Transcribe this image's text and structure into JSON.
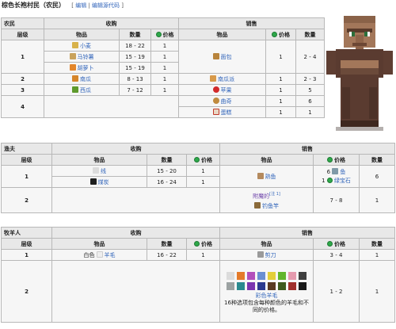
{
  "header": {
    "title": "棕色长袍村民（农民）",
    "edit": "编辑",
    "edit_source": "编辑源代码"
  },
  "emerald_price_label": "价格",
  "farmer": {
    "profession": "农民",
    "buy_header": "收购",
    "sell_header": "销售",
    "col_tier": "层级",
    "col_item": "物品",
    "col_qty": "数量",
    "col_qty2": "数量",
    "tiers": [
      {
        "tier": "1",
        "buys": [
          {
            "item": "小麦",
            "qty": "18 - 22",
            "price": "1"
          },
          {
            "item": "马铃薯",
            "qty": "15 - 19",
            "price": "1"
          },
          {
            "item": "胡萝卜",
            "qty": "15 - 19",
            "price": "1"
          }
        ],
        "sells": [
          {
            "item": "面包",
            "price": "1",
            "qty": "2 - 4"
          }
        ]
      },
      {
        "tier": "2",
        "buys": [
          {
            "item": "南瓜",
            "qty": "8 - 13",
            "price": "1"
          }
        ],
        "sells": [
          {
            "item": "南瓜派",
            "price": "1",
            "qty": "2 - 3"
          }
        ]
      },
      {
        "tier": "3",
        "buys": [
          {
            "item": "西瓜",
            "qty": "7 - 12",
            "price": "1"
          }
        ],
        "sells": [
          {
            "item": "苹果",
            "price": "1",
            "qty": "5"
          }
        ]
      },
      {
        "tier": "4",
        "sells": [
          {
            "item": "曲奇",
            "price": "1",
            "qty": "6"
          },
          {
            "item": "蛋糕",
            "price": "1",
            "qty": "1"
          }
        ]
      }
    ]
  },
  "fisherman": {
    "profession": "渔夫",
    "buy_header": "收购",
    "sell_header": "销售",
    "col_tier": "层级",
    "col_item": "物品",
    "col_qty": "数量",
    "col_qty2": "数量",
    "tier1": {
      "tier": "1",
      "buys": [
        {
          "item": "线",
          "qty": "15 - 20",
          "price": "1"
        },
        {
          "item": "煤炭",
          "qty": "16 - 24",
          "price": "1"
        }
      ],
      "sell": {
        "item": "熟鱼",
        "price_a": "6",
        "price_a_item": "鱼",
        "price_b": "1",
        "price_b_item": "绿宝石",
        "qty": "6"
      }
    },
    "tier2": {
      "tier": "2",
      "sell": {
        "prefix": "附魔的",
        "note": "[注 1]",
        "item": "钓鱼竿",
        "price": "7 - 8",
        "qty": "1"
      }
    }
  },
  "shepherd": {
    "profession": "牧羊人",
    "buy_header": "收购",
    "sell_header": "销售",
    "col_tier": "层级",
    "col_item": "物品",
    "col_qty": "数量",
    "col_qty2": "数量",
    "tier1": {
      "tier": "1",
      "buy": {
        "color": "白色",
        "item": "羊毛",
        "qty": "16 - 22",
        "price": "1"
      },
      "sell": {
        "item": "剪刀",
        "price": "3 - 4",
        "qty": "1"
      }
    },
    "tier2": {
      "tier": "2",
      "sell": {
        "item": "彩色羊毛",
        "note": "16种选项包含每种颜色的羊毛和不同的价格。",
        "price": "1 - 2",
        "qty": "1"
      }
    },
    "wool_colors": [
      "#dcdcdc",
      "#e47a2a",
      "#b24fbb",
      "#6a8fd2",
      "#e3cf3a",
      "#62b52c",
      "#e59aae",
      "#3f3f3f",
      "#9ca2a2",
      "#2a8a8f",
      "#7b35b0",
      "#2c3a8f",
      "#5a3a22",
      "#3f5a1e",
      "#a0302c",
      "#1a1a1a"
    ]
  }
}
